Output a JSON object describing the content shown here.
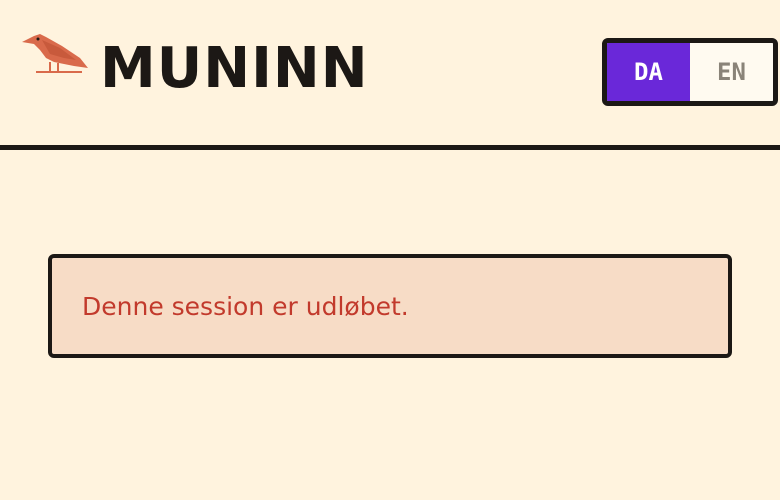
{
  "header": {
    "brand": "MUNINN",
    "logo_icon": "raven-icon",
    "language": {
      "options": [
        "DA",
        "EN"
      ],
      "selected": "DA"
    }
  },
  "alert": {
    "message": "Denne session er udløbet."
  },
  "colors": {
    "background": "#fff3de",
    "text": "#1c1815",
    "accent": "#6a28d9",
    "logo": "#d96a4b",
    "alert_bg": "#f7dcc6",
    "alert_text": "#c23a2c"
  }
}
